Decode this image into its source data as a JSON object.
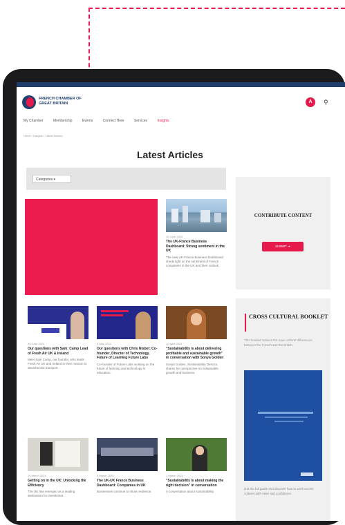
{
  "brand": {
    "name": "FRENCH CHAMBER OF GREAT BRITAIN",
    "accent": "#e8194e",
    "navy": "#213e6b"
  },
  "header": {
    "user_initial": "A",
    "search_icon": "search-icon"
  },
  "nav": {
    "items": [
      "My Chamber",
      "Membership",
      "Events",
      "Connect Here",
      "Services",
      "Insights"
    ]
  },
  "breadcrumb": "Home › Insights › Latest Articles",
  "page": {
    "title": "Latest Articles"
  },
  "filter": {
    "label": "Categories ▾"
  },
  "articles": [
    {
      "date": "10 June 2024",
      "title": "The UK-France Business Dashboard: Strong sentiment in the UK",
      "excerpt": "The new UK-France Business Dashboard sheds light on the sentiment of French companies in the UK and their outlook."
    },
    {
      "date": "20 June 2024",
      "title": "Our questions with Sam: Camp Lead of Fresh Air UK & Ireland",
      "excerpt": "Meet Sam Camp, our founder, who leads Fresh Air UK and Ireland in their mission to decarbonise transport."
    },
    {
      "date": "3 May 2024",
      "title": "Our questions with Chris Nisbet: Co-founder, Director of Technology, Future of Learning Future Labs",
      "excerpt": "Co-founder of Future Labs working on the future of learning and technology in education."
    },
    {
      "date": "10 April 2024",
      "title": "\"Sustainability is about delivering profitable and sustainable growth\" in conversation with Sonya Golden",
      "excerpt": "Sonya Golden, Sustainability Director, shares her perspective on sustainable growth and business."
    },
    {
      "date": "15 March 2024",
      "title": "Getting on in the UK: Unlocking the Efficiency",
      "excerpt": "The UK has emerged as a leading destination for investment."
    },
    {
      "date": "5 March 2024",
      "title": "The UK-UK France Business Dashboard: Companies in UK",
      "excerpt": "Businesses continue to show resilience."
    },
    {
      "date": "1 March 2024",
      "title": "\"Sustainability is about making the right decision\" in conversation",
      "excerpt": "A conversation about sustainability."
    }
  ],
  "sidebar": {
    "content_box": {
      "title": "CONTRIBUTE CONTENT",
      "button": "SUBMIT ➜"
    },
    "booklet": {
      "title": "CROSS CULTURAL BOOKLET",
      "text": "This booklet outlines the main cultural differences between the French and the British.",
      "text2": "Get the full guide and discover how to work across cultures with ease and confidence."
    }
  }
}
